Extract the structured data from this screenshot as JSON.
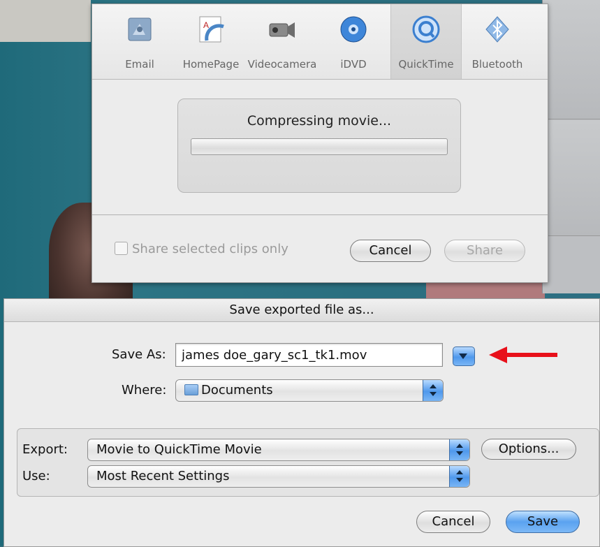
{
  "share_window": {
    "toolbar": [
      {
        "label": "Email",
        "icon": "email-icon"
      },
      {
        "label": "HomePage",
        "icon": "homepage-icon"
      },
      {
        "label": "Videocamera",
        "icon": "videocamera-icon"
      },
      {
        "label": "iDVD",
        "icon": "idvd-icon"
      },
      {
        "label": "QuickTime",
        "icon": "quicktime-icon",
        "selected": true
      },
      {
        "label": "Bluetooth",
        "icon": "bluetooth-icon"
      }
    ],
    "progress_text": "Compressing movie...",
    "progress": 0,
    "share_selected_label": "Share selected clips only",
    "cancel_label": "Cancel",
    "share_label": "Share"
  },
  "save_sheet": {
    "title": "Save exported file as...",
    "save_as_label": "Save As:",
    "save_as_value": "james doe_gary_sc1_tk1.mov",
    "where_label": "Where:",
    "where_value": "Documents",
    "export_label": "Export:",
    "export_value": "Movie to QuickTime Movie",
    "options_label": "Options...",
    "use_label": "Use:",
    "use_value": "Most Recent Settings",
    "cancel_label": "Cancel",
    "save_label": "Save"
  },
  "colors": {
    "accent_blue": "#5aa2f0",
    "annotation_red": "#e8101a"
  }
}
